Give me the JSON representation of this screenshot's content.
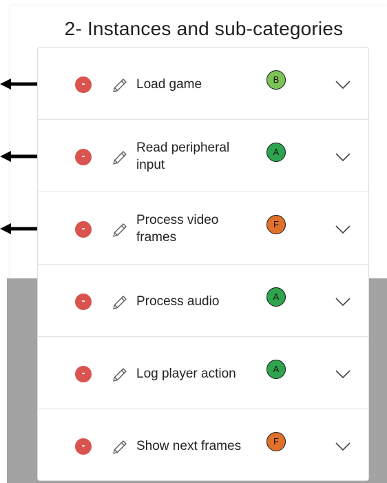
{
  "title": "2- Instances and sub-categories",
  "items": [
    {
      "label": "Load game",
      "grade": "B",
      "grade_color": "#7cc254",
      "arrow": true
    },
    {
      "label": "Read peripheral input",
      "grade": "A",
      "grade_color": "#2ea44f",
      "arrow": true
    },
    {
      "label": "Process video frames",
      "grade": "F",
      "grade_color": "#e0702a",
      "arrow": true
    },
    {
      "label": "Process audio",
      "grade": "A",
      "grade_color": "#2ea44f",
      "arrow": false
    },
    {
      "label": "Log player action",
      "grade": "A",
      "grade_color": "#2ea44f",
      "arrow": false
    },
    {
      "label": "Show next frames",
      "grade": "F",
      "grade_color": "#e0702a",
      "arrow": false
    }
  ],
  "remove_symbol": "-",
  "icons": {
    "remove": "minus-circle-icon",
    "edit": "pencil-icon",
    "expand": "chevron-down-icon",
    "pointer": "arrow-left-icon"
  }
}
